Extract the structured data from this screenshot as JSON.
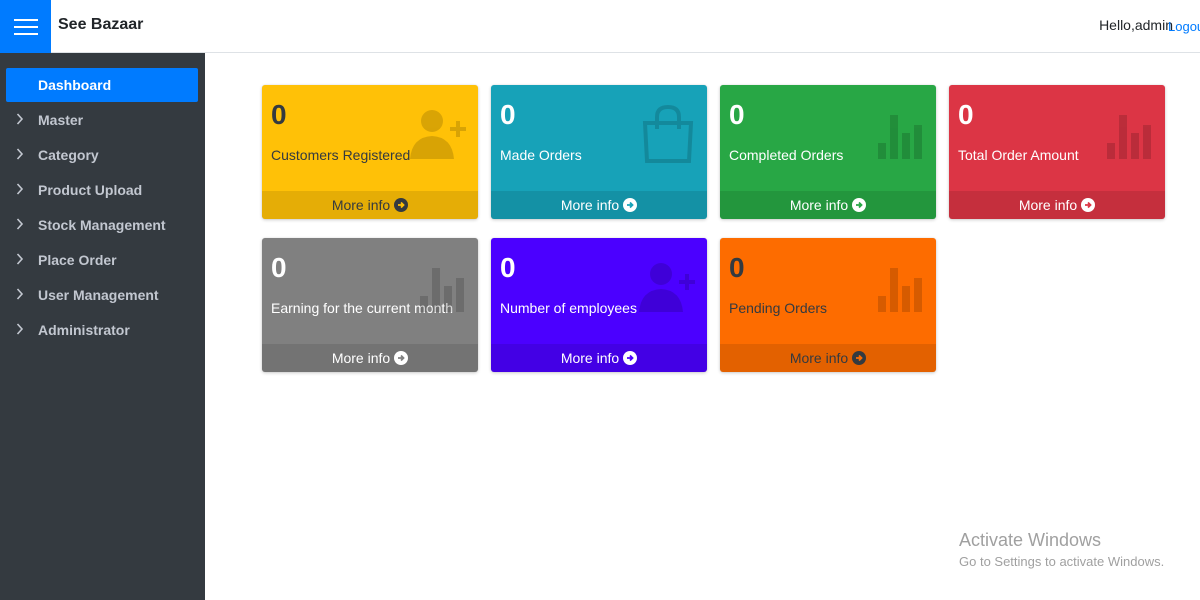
{
  "header": {
    "brand": "See Bazaar",
    "greeting": "Hello,admin",
    "logout_label": "Logout"
  },
  "sidebar": {
    "items": [
      {
        "label": "Dashboard",
        "active": true
      },
      {
        "label": "Master"
      },
      {
        "label": "Category"
      },
      {
        "label": "Product Upload"
      },
      {
        "label": "Stock Management"
      },
      {
        "label": "Place Order"
      },
      {
        "label": "User Management"
      },
      {
        "label": "Administrator"
      }
    ]
  },
  "cards": [
    {
      "count": "0",
      "label": "Customers Registered",
      "footer": "More info",
      "color": "#ffc107",
      "text_color": "#343a40",
      "icon": "user-plus-icon"
    },
    {
      "count": "0",
      "label": "Made Orders",
      "footer": "More info",
      "color": "#17a2b8",
      "text_color": "#ffffff",
      "icon": "shopping-bag-icon"
    },
    {
      "count": "0",
      "label": "Completed Orders",
      "footer": "More info",
      "color": "#28a745",
      "text_color": "#ffffff",
      "icon": "bar-chart-icon"
    },
    {
      "count": "0",
      "label": "Total Order Amount",
      "footer": "More info",
      "color": "#dc3545",
      "text_color": "#ffffff",
      "icon": "bar-chart-icon"
    },
    {
      "count": "0",
      "label": "Earning for the current month",
      "footer": "More info",
      "color": "#808080",
      "text_color": "#ffffff",
      "icon": "bar-chart-icon"
    },
    {
      "count": "0",
      "label": "Number of employees",
      "footer": "More info",
      "color": "#4b00ff",
      "text_color": "#ffffff",
      "icon": "user-plus-icon"
    },
    {
      "count": "0",
      "label": "Pending Orders",
      "footer": "More info",
      "color": "#fd6c00",
      "text_color": "#343a40",
      "icon": "bar-chart-icon"
    }
  ],
  "watermark": {
    "title": "Activate Windows",
    "subtitle": "Go to Settings to activate Windows."
  },
  "colors": {
    "accent": "#007bff",
    "sidebar_bg": "#343a40"
  }
}
